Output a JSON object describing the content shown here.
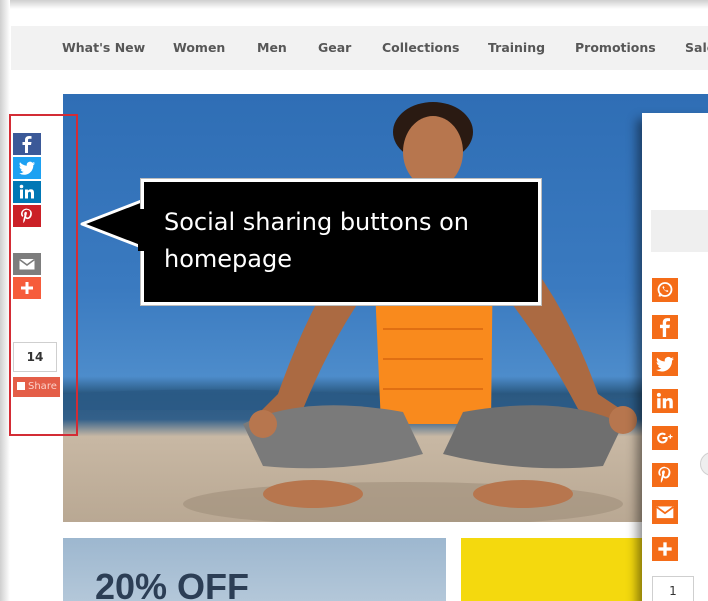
{
  "nav": {
    "items": [
      "What's New",
      "Women",
      "Men",
      "Gear",
      "Collections",
      "Training",
      "Promotions",
      "Sale"
    ]
  },
  "left_share": {
    "buttons": [
      {
        "icon": "facebook-icon",
        "color": "#3b5998"
      },
      {
        "icon": "twitter-icon",
        "color": "#1da1f2"
      },
      {
        "icon": "linkedin-icon",
        "color": "#0077b5"
      },
      {
        "icon": "pinterest-icon",
        "color": "#cb2027"
      },
      {
        "icon": "email-icon",
        "color": "#7d7d7d"
      },
      {
        "icon": "plus-icon",
        "color": "#f65c3b"
      }
    ],
    "count": "14",
    "label": "Share"
  },
  "callout": {
    "text": "Social sharing buttons on homepage"
  },
  "promo": {
    "title": "20% OFF"
  },
  "right_share": {
    "accent": "#f46c18",
    "buttons": [
      "whatsapp-icon",
      "facebook-icon",
      "twitter-icon",
      "linkedin-icon",
      "google-plus-icon",
      "pinterest-icon",
      "email-icon",
      "plus-icon"
    ],
    "count": "1"
  }
}
